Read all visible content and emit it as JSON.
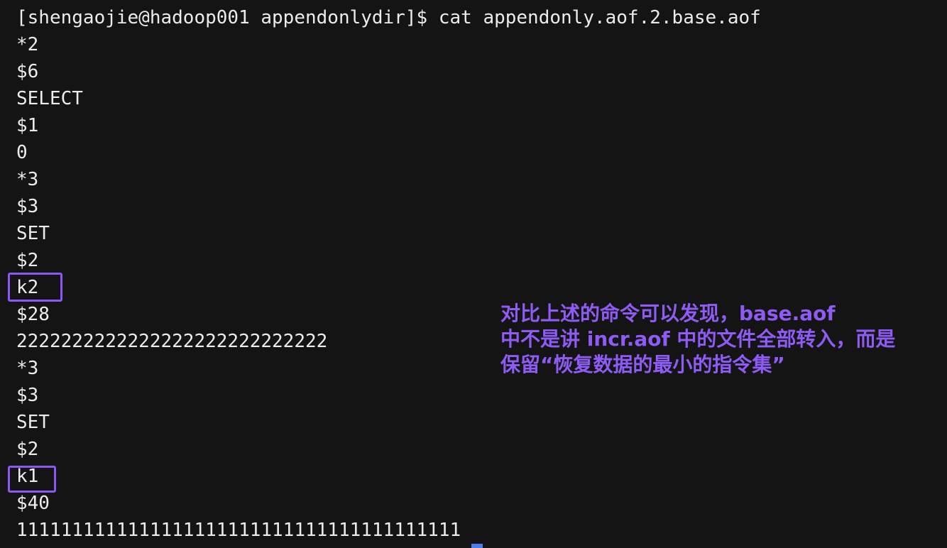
{
  "terminal": {
    "prompt": "[shengaojie@hadoop001 appendonlydir]$ cat appendonly.aof.2.base.aof",
    "output_lines": [
      "*2",
      "$6",
      "SELECT",
      "$1",
      "0",
      "*3",
      "$3",
      "SET",
      "$2",
      "k2",
      "$28",
      "2222222222222222222222222222",
      "*3",
      "$3",
      "SET",
      "$2",
      "k1",
      "$40",
      "1111111111111111111111111111111111111111"
    ]
  },
  "annotation": {
    "lines": [
      "对比上述的命令可以发现，base.aof",
      "中不是讲 incr.aof 中的文件全部转入，而是",
      "保留“恢复数据的最小的指令集”"
    ],
    "color": "#8e5cf5"
  },
  "highlight_color": "#8a58f2",
  "highlighted_keys": [
    "k2",
    "k1"
  ]
}
